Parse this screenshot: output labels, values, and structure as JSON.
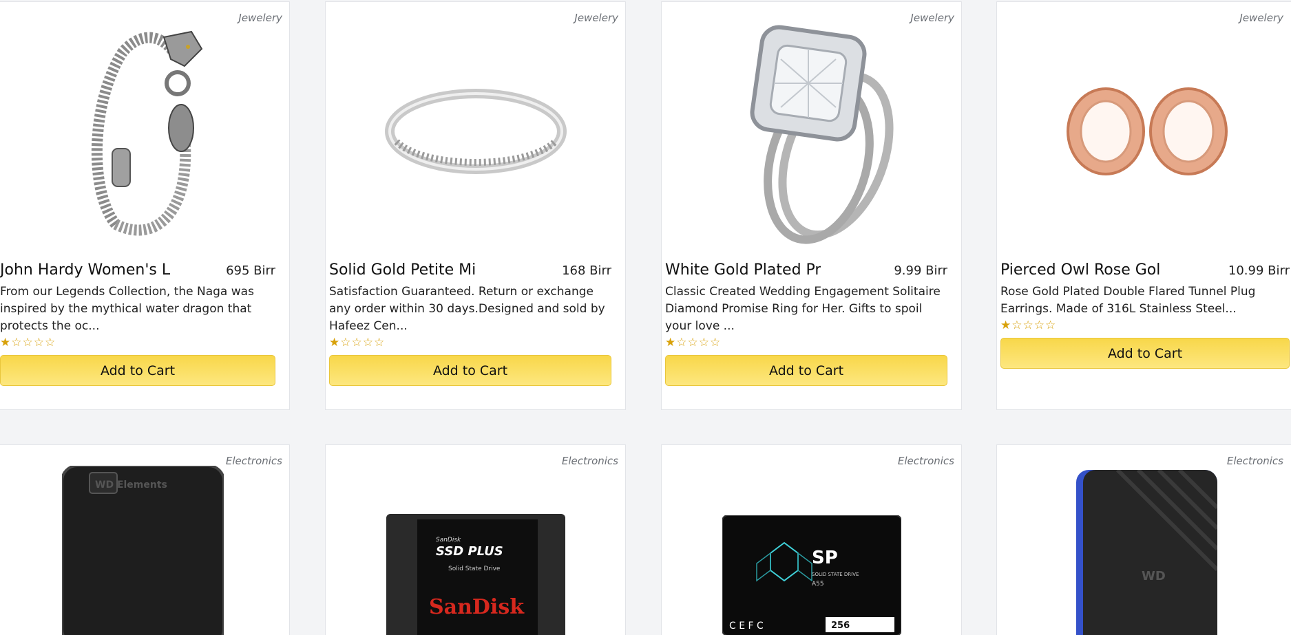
{
  "products": [
    {
      "category": "Jewelery",
      "title": "John Hardy Women's L",
      "price": "695 Birr",
      "description": "From our Legends Collection, the Naga was inspired by the mythical water dragon that protects the oc...",
      "stars": "★☆☆☆☆",
      "rating": 1,
      "button_label": "Add to Cart",
      "image_icon": "bracelet-image"
    },
    {
      "category": "Jewelery",
      "title": "Solid Gold Petite Mi",
      "price": "168 Birr",
      "description": "Satisfaction Guaranteed. Return or exchange any order within 30 days.Designed and sold by Hafeez Cen...",
      "stars": "★☆☆☆☆",
      "rating": 1,
      "button_label": "Add to Cart",
      "image_icon": "ring-image"
    },
    {
      "category": "Jewelery",
      "title": "White Gold Plated Pr",
      "price": "9.99 Birr",
      "description": "Classic Created Wedding Engagement Solitaire Diamond Promise Ring for Her. Gifts to spoil your love ...",
      "stars": "★☆☆☆☆",
      "rating": 1,
      "button_label": "Add to Cart",
      "image_icon": "engagement-ring-image"
    },
    {
      "category": "Jewelery",
      "title": "Pierced Owl Rose Gol",
      "price": "10.99 Birr",
      "description": "Rose Gold Plated Double Flared Tunnel Plug Earrings. Made of 316L Stainless Steel...",
      "stars": "★☆☆☆☆",
      "rating": 1,
      "button_label": "Add to Cart",
      "image_icon": "tunnel-plug-image"
    },
    {
      "category": "Electronics",
      "image_icon": "external-hard-drive-image",
      "image_text": "WD Elements"
    },
    {
      "category": "Electronics",
      "image_icon": "ssd-image",
      "image_text_top": "SanDisk",
      "image_text_main": "SSD PLUS",
      "image_text_sub": "Solid State Drive",
      "image_text_brand": "SanDisk"
    },
    {
      "category": "Electronics",
      "image_icon": "ssd-image",
      "image_text_brand": "SP",
      "image_text_sub": "SOLID STATE DRIVE",
      "image_text_model": "A55",
      "image_text_capacity": "256"
    },
    {
      "category": "Electronics",
      "image_icon": "portable-drive-image",
      "image_text": "WD"
    }
  ],
  "colors": {
    "page_bg": "#f3f4f6",
    "button": "#f8d74a",
    "star": "#d8a10a"
  }
}
